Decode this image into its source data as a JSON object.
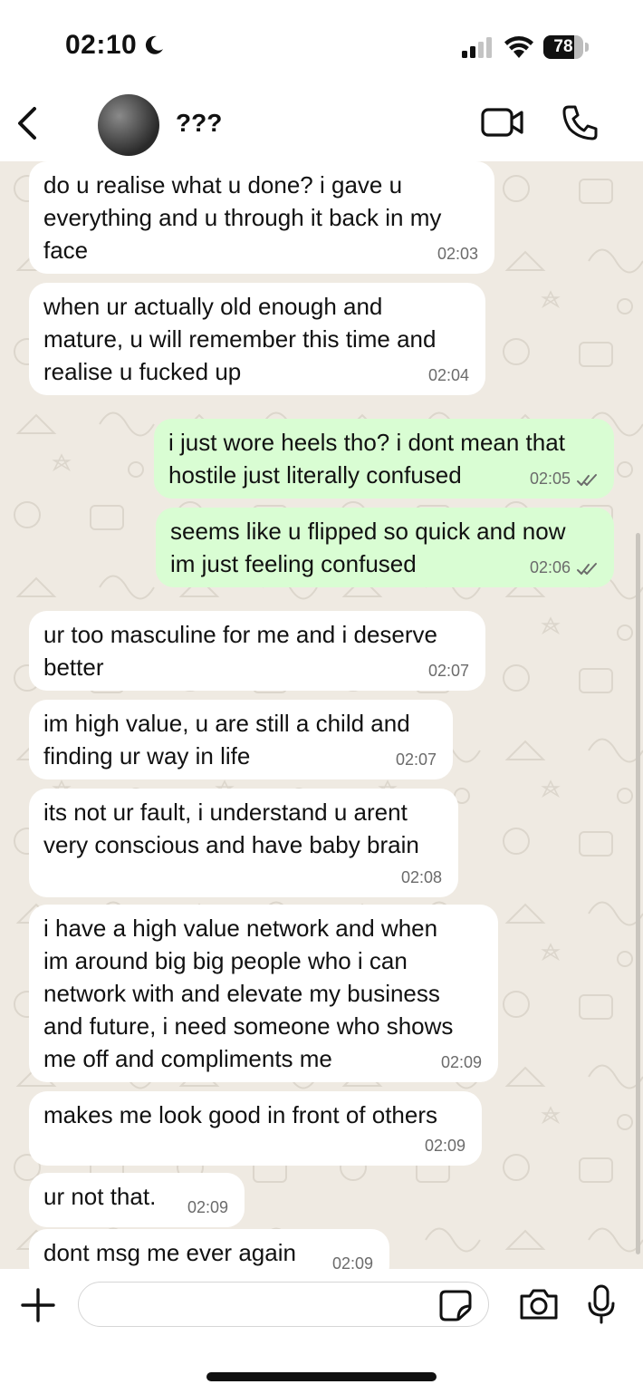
{
  "status_bar": {
    "time": "02:10",
    "battery": "78",
    "battery_level": 0.78
  },
  "header": {
    "contact_name": "???"
  },
  "messages": [
    {
      "dir": "in",
      "text": "do u realise what u done? i gave u\neverything and u through it back in my\nface",
      "time": "02:03"
    },
    {
      "dir": "in",
      "text": "when ur actually old enough and\nmature, u will remember this time and\nrealise u fucked up",
      "time": "02:04"
    },
    {
      "dir": "out",
      "text": "i just wore heels tho? i dont mean that\nhostile just literally confused",
      "time": "02:05",
      "status": "read"
    },
    {
      "dir": "out",
      "text": "seems like u flipped so quick and now\nim just feeling confused",
      "time": "02:06",
      "status": "read"
    },
    {
      "dir": "in",
      "text": "ur too masculine for me and i deserve\nbetter",
      "time": "02:07"
    },
    {
      "dir": "in",
      "text": "im high value, u are still a child and\nfinding ur way in life",
      "time": "02:07"
    },
    {
      "dir": "in",
      "text": "its not ur fault, i understand u arent\nvery conscious and have baby brain",
      "time": "02:08"
    },
    {
      "dir": "in",
      "text": "i have a high value network and when\nim around big big people who i can\nnetwork with and elevate my business\nand future, i need someone who shows\nme off and compliments me",
      "time": "02:09"
    },
    {
      "dir": "in",
      "text": "makes me look good in front of others",
      "time": "02:09"
    },
    {
      "dir": "in",
      "text": "ur not that.",
      "time": "02:09"
    },
    {
      "dir": "in",
      "text": "dont msg me ever again",
      "time": "02:09"
    }
  ],
  "colors": {
    "incoming": "#ffffff",
    "outgoing": "#d9fdd3",
    "wallpaper": "#efeae2",
    "accent": "#111111"
  },
  "icons": {
    "back": "chevron-left-icon",
    "video": "video-camera-icon",
    "call": "phone-icon",
    "plus": "plus-icon",
    "sticker": "sticker-icon",
    "camera": "camera-icon",
    "mic": "microphone-icon"
  }
}
